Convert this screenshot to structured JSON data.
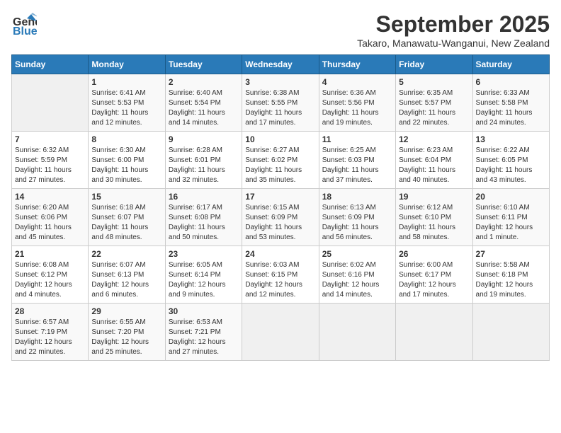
{
  "logo": {
    "general": "General",
    "blue": "Blue"
  },
  "title": "September 2025",
  "location": "Takaro, Manawatu-Wanganui, New Zealand",
  "days_of_week": [
    "Sunday",
    "Monday",
    "Tuesday",
    "Wednesday",
    "Thursday",
    "Friday",
    "Saturday"
  ],
  "weeks": [
    [
      {
        "day": "",
        "info": ""
      },
      {
        "day": "1",
        "info": "Sunrise: 6:41 AM\nSunset: 5:53 PM\nDaylight: 11 hours\nand 12 minutes."
      },
      {
        "day": "2",
        "info": "Sunrise: 6:40 AM\nSunset: 5:54 PM\nDaylight: 11 hours\nand 14 minutes."
      },
      {
        "day": "3",
        "info": "Sunrise: 6:38 AM\nSunset: 5:55 PM\nDaylight: 11 hours\nand 17 minutes."
      },
      {
        "day": "4",
        "info": "Sunrise: 6:36 AM\nSunset: 5:56 PM\nDaylight: 11 hours\nand 19 minutes."
      },
      {
        "day": "5",
        "info": "Sunrise: 6:35 AM\nSunset: 5:57 PM\nDaylight: 11 hours\nand 22 minutes."
      },
      {
        "day": "6",
        "info": "Sunrise: 6:33 AM\nSunset: 5:58 PM\nDaylight: 11 hours\nand 24 minutes."
      }
    ],
    [
      {
        "day": "7",
        "info": "Sunrise: 6:32 AM\nSunset: 5:59 PM\nDaylight: 11 hours\nand 27 minutes."
      },
      {
        "day": "8",
        "info": "Sunrise: 6:30 AM\nSunset: 6:00 PM\nDaylight: 11 hours\nand 30 minutes."
      },
      {
        "day": "9",
        "info": "Sunrise: 6:28 AM\nSunset: 6:01 PM\nDaylight: 11 hours\nand 32 minutes."
      },
      {
        "day": "10",
        "info": "Sunrise: 6:27 AM\nSunset: 6:02 PM\nDaylight: 11 hours\nand 35 minutes."
      },
      {
        "day": "11",
        "info": "Sunrise: 6:25 AM\nSunset: 6:03 PM\nDaylight: 11 hours\nand 37 minutes."
      },
      {
        "day": "12",
        "info": "Sunrise: 6:23 AM\nSunset: 6:04 PM\nDaylight: 11 hours\nand 40 minutes."
      },
      {
        "day": "13",
        "info": "Sunrise: 6:22 AM\nSunset: 6:05 PM\nDaylight: 11 hours\nand 43 minutes."
      }
    ],
    [
      {
        "day": "14",
        "info": "Sunrise: 6:20 AM\nSunset: 6:06 PM\nDaylight: 11 hours\nand 45 minutes."
      },
      {
        "day": "15",
        "info": "Sunrise: 6:18 AM\nSunset: 6:07 PM\nDaylight: 11 hours\nand 48 minutes."
      },
      {
        "day": "16",
        "info": "Sunrise: 6:17 AM\nSunset: 6:08 PM\nDaylight: 11 hours\nand 50 minutes."
      },
      {
        "day": "17",
        "info": "Sunrise: 6:15 AM\nSunset: 6:09 PM\nDaylight: 11 hours\nand 53 minutes."
      },
      {
        "day": "18",
        "info": "Sunrise: 6:13 AM\nSunset: 6:09 PM\nDaylight: 11 hours\nand 56 minutes."
      },
      {
        "day": "19",
        "info": "Sunrise: 6:12 AM\nSunset: 6:10 PM\nDaylight: 11 hours\nand 58 minutes."
      },
      {
        "day": "20",
        "info": "Sunrise: 6:10 AM\nSunset: 6:11 PM\nDaylight: 12 hours\nand 1 minute."
      }
    ],
    [
      {
        "day": "21",
        "info": "Sunrise: 6:08 AM\nSunset: 6:12 PM\nDaylight: 12 hours\nand 4 minutes."
      },
      {
        "day": "22",
        "info": "Sunrise: 6:07 AM\nSunset: 6:13 PM\nDaylight: 12 hours\nand 6 minutes."
      },
      {
        "day": "23",
        "info": "Sunrise: 6:05 AM\nSunset: 6:14 PM\nDaylight: 12 hours\nand 9 minutes."
      },
      {
        "day": "24",
        "info": "Sunrise: 6:03 AM\nSunset: 6:15 PM\nDaylight: 12 hours\nand 12 minutes."
      },
      {
        "day": "25",
        "info": "Sunrise: 6:02 AM\nSunset: 6:16 PM\nDaylight: 12 hours\nand 14 minutes."
      },
      {
        "day": "26",
        "info": "Sunrise: 6:00 AM\nSunset: 6:17 PM\nDaylight: 12 hours\nand 17 minutes."
      },
      {
        "day": "27",
        "info": "Sunrise: 5:58 AM\nSunset: 6:18 PM\nDaylight: 12 hours\nand 19 minutes."
      }
    ],
    [
      {
        "day": "28",
        "info": "Sunrise: 6:57 AM\nSunset: 7:19 PM\nDaylight: 12 hours\nand 22 minutes."
      },
      {
        "day": "29",
        "info": "Sunrise: 6:55 AM\nSunset: 7:20 PM\nDaylight: 12 hours\nand 25 minutes."
      },
      {
        "day": "30",
        "info": "Sunrise: 6:53 AM\nSunset: 7:21 PM\nDaylight: 12 hours\nand 27 minutes."
      },
      {
        "day": "",
        "info": ""
      },
      {
        "day": "",
        "info": ""
      },
      {
        "day": "",
        "info": ""
      },
      {
        "day": "",
        "info": ""
      }
    ]
  ]
}
